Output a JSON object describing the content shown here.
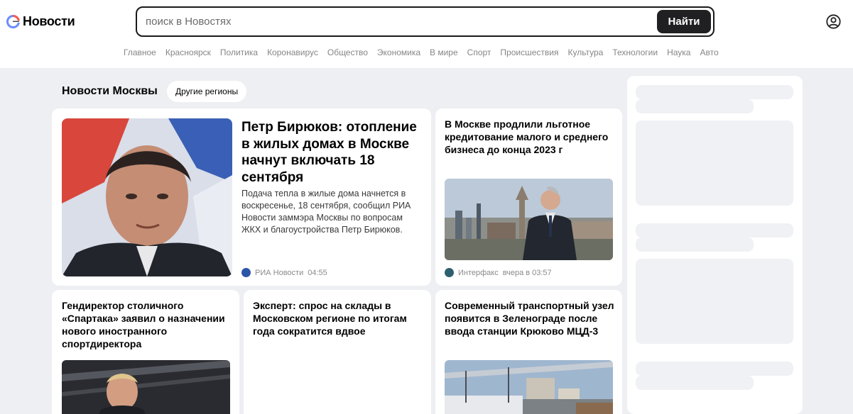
{
  "header": {
    "logo_text": "Новости",
    "search_placeholder": "поиск в Новостях",
    "search_button": "Найти"
  },
  "nav": [
    "Главное",
    "Красноярск",
    "Политика",
    "Коронавирус",
    "Общество",
    "Экономика",
    "В мире",
    "Спорт",
    "Происшествия",
    "Культура",
    "Технологии",
    "Наука",
    "Авто"
  ],
  "region": {
    "title": "Новости Москвы",
    "other_regions": "Другие регионы"
  },
  "main_story": {
    "headline": "Петр Бирюков: отопление в жилых домах в Москве начнут включать 18 сентября",
    "snippet": "Подача тепла в жилые дома начнется в воскресенье, 18 сентября, сообщил РИА Новости заммэра Москвы по вопросам ЖКХ и благоустройства Петр Бирюков.",
    "source": "РИА Новости",
    "time": "04:55"
  },
  "story_credit": {
    "headline": "В Москве продлили льготное кредитование малого и среднего бизнеса до конца 2023 г",
    "source": "Интерфакс",
    "time": "вчера в 03:57"
  },
  "story_spartak": {
    "headline": "Гендиректор столичного «Спартака» заявил о назначении нового иностранного спортдиректора"
  },
  "story_warehouse": {
    "headline": "Эксперт: спрос на склады в Московском регионе по итогам года сократится вдвое"
  },
  "story_transport": {
    "headline": "Современный транспортный узел появится в Зеленограде после ввода станции Крюково МЦД-3"
  },
  "colors": {
    "accent_dark": "#202022",
    "page_bg": "#eeeff2",
    "muted_text": "#868686"
  }
}
